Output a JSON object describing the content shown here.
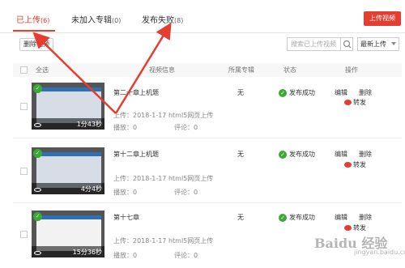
{
  "tabs": [
    {
      "label": "已上传",
      "count": "(6)"
    },
    {
      "label": "未加入专辑",
      "count": "(0)"
    },
    {
      "label": "发布失败",
      "count": "(8)"
    }
  ],
  "upload_button": "上传视频",
  "toolbar": {
    "delete_button": "删除视频",
    "search_placeholder": "搜索已上传视频",
    "sort_label": "最新上传"
  },
  "table_headers": {
    "select_all": "全选",
    "video_info": "视频信息",
    "album": "所属专辑",
    "status": "状态",
    "actions": "操作"
  },
  "rows": [
    {
      "title": "第二十章上机题",
      "uploaded": "上传：2018-1-17 html5网页上传",
      "plays": "播放：0",
      "comments": "评论：0",
      "album": "无",
      "status": "发布成功",
      "duration": "1分43秒",
      "edit": "编辑",
      "delete": "删除",
      "share": "转发"
    },
    {
      "title": "第十二章上机题",
      "uploaded": "上传：2018-1-17 html5网页上传",
      "plays": "播放：0",
      "comments": "评论：0",
      "album": "无",
      "status": "发布成功",
      "duration": "4分4秒",
      "edit": "编辑",
      "delete": "删除",
      "share": "转发"
    },
    {
      "title": "第十七章",
      "uploaded": "上传：2018-1-17 html5网页上传",
      "plays": "播放：0",
      "comments": "评论：0",
      "album": "无",
      "status": "发布成功",
      "duration": "15分36秒",
      "edit": "编辑",
      "delete": "删除",
      "share": "转发"
    }
  ],
  "watermark": {
    "text": "Baidu 经验",
    "sub": "jingyan.baidu.com"
  },
  "colors": {
    "accent": "#e53e30",
    "success": "#3aaa35"
  }
}
